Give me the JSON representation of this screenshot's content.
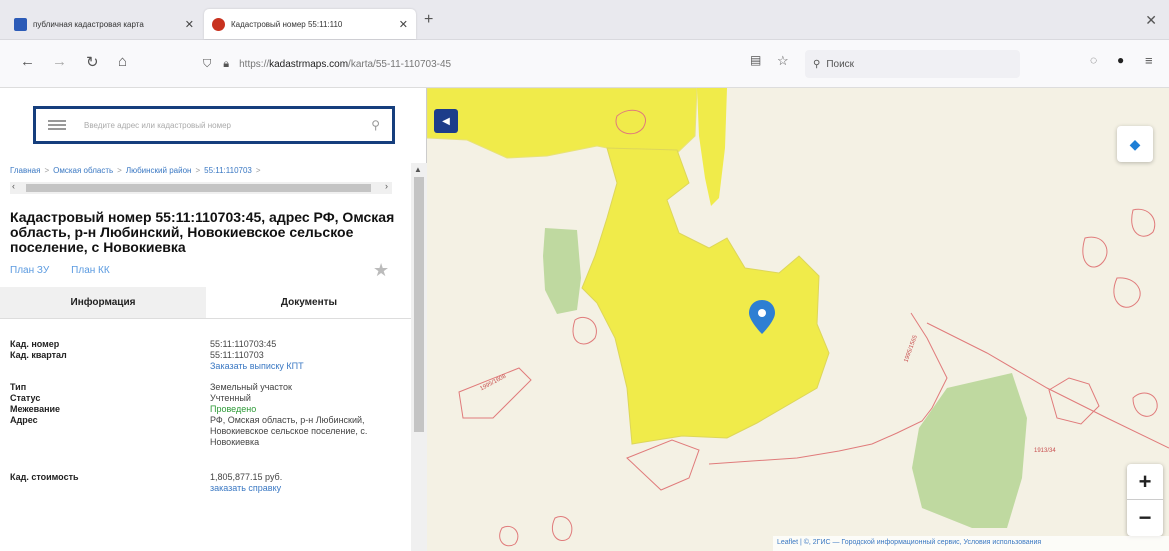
{
  "browser": {
    "tabs": [
      {
        "title": "публичная кадастровая карта",
        "active": false
      },
      {
        "title": "Кадастровый номер 55:11:110",
        "active": true
      }
    ],
    "url_prefix": "https://",
    "url_domain": "kadastrmaps.com",
    "url_path": "/karta/55-11-110703-45",
    "search_placeholder": "Поиск"
  },
  "sidebar": {
    "search_placeholder": "Введите адрес или кадастровый номер",
    "breadcrumb": [
      "Главная",
      "Омская область",
      "Любинский район",
      "55:11:110703"
    ],
    "title": "Кадастровый номер 55:11:110703:45, адрес РФ, Омская область, р-н Любинский, Новокиевское сельское поселение, с Новокиевка",
    "plan_links": [
      "План ЗУ",
      "План КК"
    ],
    "tabs": [
      "Информация",
      "Документы"
    ],
    "info": [
      {
        "key": "Кад. номер",
        "value": "55:11:110703:45"
      },
      {
        "key": "Кад. квартал",
        "value": "55:11:110703",
        "link": "Заказать выписку КПТ"
      },
      {
        "key": "Тип",
        "value": "Земельный участок"
      },
      {
        "key": "Статус",
        "value": "Учтенный"
      },
      {
        "key": "Межевание",
        "value": "Проведено"
      },
      {
        "key": "Адрес",
        "value": "РФ, Омская область, р-н Любинский, Новокиевское сельское поселение, с. Новокиевка"
      },
      {
        "key": "Кад. стоимость",
        "value": "1,805,877.15 руб.",
        "link": "заказать справку"
      }
    ]
  },
  "map": {
    "labels": [
      "1995/1608",
      "1995/1565",
      "1913/34"
    ],
    "attribution": "Leaflet | ©, 2ГИС — Городской информационный сервис, Условия использования",
    "colors": {
      "parcel": "#f0eb4a",
      "field": "#bfd9a0",
      "boundary": "#e07b7b",
      "base": "#f4f1e4",
      "marker": "#2e7fd3"
    }
  }
}
